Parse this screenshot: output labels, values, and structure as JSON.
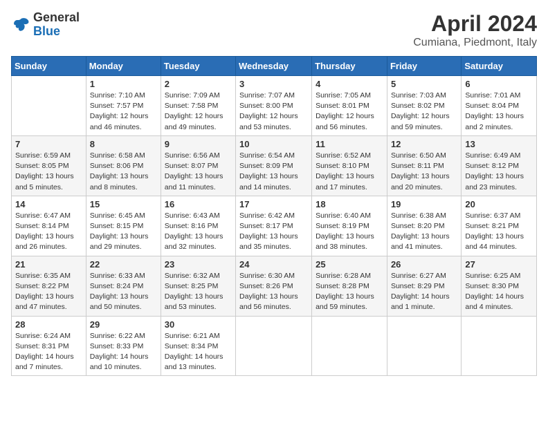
{
  "header": {
    "logo_general": "General",
    "logo_blue": "Blue",
    "month": "April 2024",
    "location": "Cumiana, Piedmont, Italy"
  },
  "weekdays": [
    "Sunday",
    "Monday",
    "Tuesday",
    "Wednesday",
    "Thursday",
    "Friday",
    "Saturday"
  ],
  "weeks": [
    [
      {
        "day": "",
        "info": ""
      },
      {
        "day": "1",
        "info": "Sunrise: 7:10 AM\nSunset: 7:57 PM\nDaylight: 12 hours\nand 46 minutes."
      },
      {
        "day": "2",
        "info": "Sunrise: 7:09 AM\nSunset: 7:58 PM\nDaylight: 12 hours\nand 49 minutes."
      },
      {
        "day": "3",
        "info": "Sunrise: 7:07 AM\nSunset: 8:00 PM\nDaylight: 12 hours\nand 53 minutes."
      },
      {
        "day": "4",
        "info": "Sunrise: 7:05 AM\nSunset: 8:01 PM\nDaylight: 12 hours\nand 56 minutes."
      },
      {
        "day": "5",
        "info": "Sunrise: 7:03 AM\nSunset: 8:02 PM\nDaylight: 12 hours\nand 59 minutes."
      },
      {
        "day": "6",
        "info": "Sunrise: 7:01 AM\nSunset: 8:04 PM\nDaylight: 13 hours\nand 2 minutes."
      }
    ],
    [
      {
        "day": "7",
        "info": "Sunrise: 6:59 AM\nSunset: 8:05 PM\nDaylight: 13 hours\nand 5 minutes."
      },
      {
        "day": "8",
        "info": "Sunrise: 6:58 AM\nSunset: 8:06 PM\nDaylight: 13 hours\nand 8 minutes."
      },
      {
        "day": "9",
        "info": "Sunrise: 6:56 AM\nSunset: 8:07 PM\nDaylight: 13 hours\nand 11 minutes."
      },
      {
        "day": "10",
        "info": "Sunrise: 6:54 AM\nSunset: 8:09 PM\nDaylight: 13 hours\nand 14 minutes."
      },
      {
        "day": "11",
        "info": "Sunrise: 6:52 AM\nSunset: 8:10 PM\nDaylight: 13 hours\nand 17 minutes."
      },
      {
        "day": "12",
        "info": "Sunrise: 6:50 AM\nSunset: 8:11 PM\nDaylight: 13 hours\nand 20 minutes."
      },
      {
        "day": "13",
        "info": "Sunrise: 6:49 AM\nSunset: 8:12 PM\nDaylight: 13 hours\nand 23 minutes."
      }
    ],
    [
      {
        "day": "14",
        "info": "Sunrise: 6:47 AM\nSunset: 8:14 PM\nDaylight: 13 hours\nand 26 minutes."
      },
      {
        "day": "15",
        "info": "Sunrise: 6:45 AM\nSunset: 8:15 PM\nDaylight: 13 hours\nand 29 minutes."
      },
      {
        "day": "16",
        "info": "Sunrise: 6:43 AM\nSunset: 8:16 PM\nDaylight: 13 hours\nand 32 minutes."
      },
      {
        "day": "17",
        "info": "Sunrise: 6:42 AM\nSunset: 8:17 PM\nDaylight: 13 hours\nand 35 minutes."
      },
      {
        "day": "18",
        "info": "Sunrise: 6:40 AM\nSunset: 8:19 PM\nDaylight: 13 hours\nand 38 minutes."
      },
      {
        "day": "19",
        "info": "Sunrise: 6:38 AM\nSunset: 8:20 PM\nDaylight: 13 hours\nand 41 minutes."
      },
      {
        "day": "20",
        "info": "Sunrise: 6:37 AM\nSunset: 8:21 PM\nDaylight: 13 hours\nand 44 minutes."
      }
    ],
    [
      {
        "day": "21",
        "info": "Sunrise: 6:35 AM\nSunset: 8:22 PM\nDaylight: 13 hours\nand 47 minutes."
      },
      {
        "day": "22",
        "info": "Sunrise: 6:33 AM\nSunset: 8:24 PM\nDaylight: 13 hours\nand 50 minutes."
      },
      {
        "day": "23",
        "info": "Sunrise: 6:32 AM\nSunset: 8:25 PM\nDaylight: 13 hours\nand 53 minutes."
      },
      {
        "day": "24",
        "info": "Sunrise: 6:30 AM\nSunset: 8:26 PM\nDaylight: 13 hours\nand 56 minutes."
      },
      {
        "day": "25",
        "info": "Sunrise: 6:28 AM\nSunset: 8:28 PM\nDaylight: 13 hours\nand 59 minutes."
      },
      {
        "day": "26",
        "info": "Sunrise: 6:27 AM\nSunset: 8:29 PM\nDaylight: 14 hours\nand 1 minute."
      },
      {
        "day": "27",
        "info": "Sunrise: 6:25 AM\nSunset: 8:30 PM\nDaylight: 14 hours\nand 4 minutes."
      }
    ],
    [
      {
        "day": "28",
        "info": "Sunrise: 6:24 AM\nSunset: 8:31 PM\nDaylight: 14 hours\nand 7 minutes."
      },
      {
        "day": "29",
        "info": "Sunrise: 6:22 AM\nSunset: 8:33 PM\nDaylight: 14 hours\nand 10 minutes."
      },
      {
        "day": "30",
        "info": "Sunrise: 6:21 AM\nSunset: 8:34 PM\nDaylight: 14 hours\nand 13 minutes."
      },
      {
        "day": "",
        "info": ""
      },
      {
        "day": "",
        "info": ""
      },
      {
        "day": "",
        "info": ""
      },
      {
        "day": "",
        "info": ""
      }
    ]
  ]
}
